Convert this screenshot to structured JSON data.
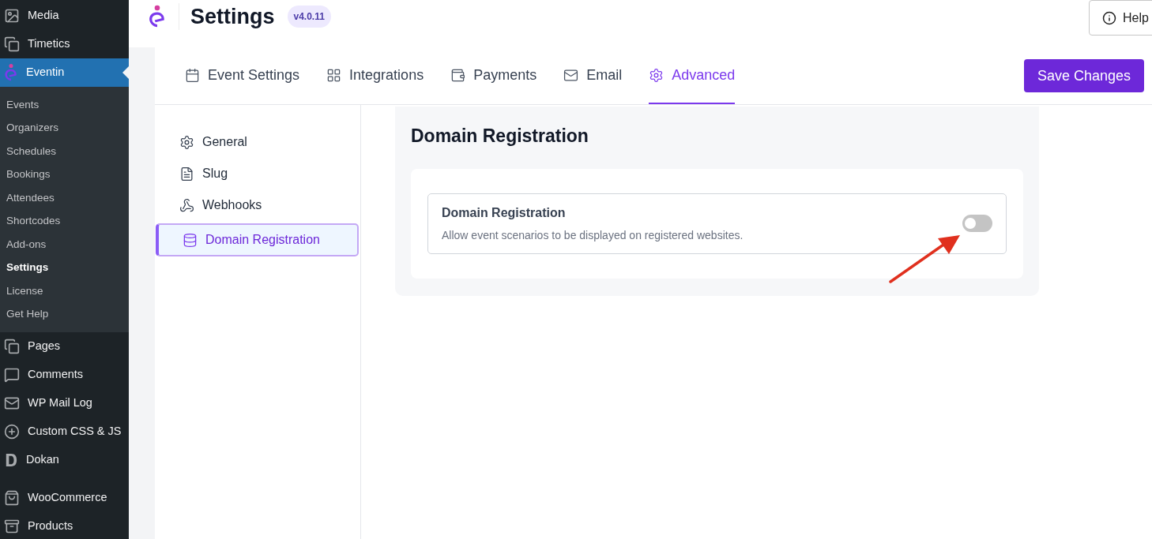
{
  "sidebar": {
    "items": [
      {
        "label": "Media",
        "kind": "media",
        "selected": false
      },
      {
        "label": "Timetics",
        "kind": "timetics",
        "selected": false
      },
      {
        "label": "Eventin",
        "kind": "eventin",
        "selected": true,
        "expanded": true,
        "children": [
          {
            "label": "Events",
            "selected": false
          },
          {
            "label": "Organizers",
            "selected": false
          },
          {
            "label": "Schedules",
            "selected": false
          },
          {
            "label": "Bookings",
            "selected": false
          },
          {
            "label": "Attendees",
            "selected": false
          },
          {
            "label": "Shortcodes",
            "selected": false
          },
          {
            "label": "Add-ons",
            "selected": false
          },
          {
            "label": "Settings",
            "selected": true
          },
          {
            "label": "License",
            "selected": false
          },
          {
            "label": "Get Help",
            "selected": false
          }
        ]
      },
      {
        "label": "Pages",
        "kind": "pages",
        "selected": false
      },
      {
        "label": "Comments",
        "kind": "comments",
        "selected": false
      },
      {
        "label": "WP Mail Log",
        "kind": "mail",
        "selected": false
      },
      {
        "label": "Custom CSS & JS",
        "kind": "plus",
        "selected": false
      },
      {
        "label": "Dokan",
        "kind": "dokan",
        "selected": false
      },
      {
        "label": "WooCommerce",
        "kind": "woo",
        "selected": false
      },
      {
        "label": "Products",
        "kind": "products",
        "selected": false
      }
    ]
  },
  "header": {
    "title": "Settings",
    "version": "v4.0.11",
    "help_button": "Help"
  },
  "tabs": [
    {
      "label": "Event Settings",
      "kind": "calendar",
      "selected": false
    },
    {
      "label": "Integrations",
      "kind": "grid",
      "selected": false
    },
    {
      "label": "Payments",
      "kind": "wallet",
      "selected": false
    },
    {
      "label": "Email",
      "kind": "mail",
      "selected": false
    },
    {
      "label": "Advanced",
      "kind": "gear",
      "selected": true
    }
  ],
  "save_button": "Save Changes",
  "subnav": [
    {
      "label": "General",
      "kind": "gear",
      "selected": false
    },
    {
      "label": "Slug",
      "kind": "file",
      "selected": false
    },
    {
      "label": "Webhooks",
      "kind": "webhook",
      "selected": false
    },
    {
      "label": "Domain Registration",
      "kind": "database",
      "selected": true
    }
  ],
  "section": {
    "title": "Domain Registration",
    "settings": [
      {
        "title": "Domain Registration",
        "description": "Allow event scenarios to be displayed on registered websites.",
        "on": false
      }
    ]
  }
}
